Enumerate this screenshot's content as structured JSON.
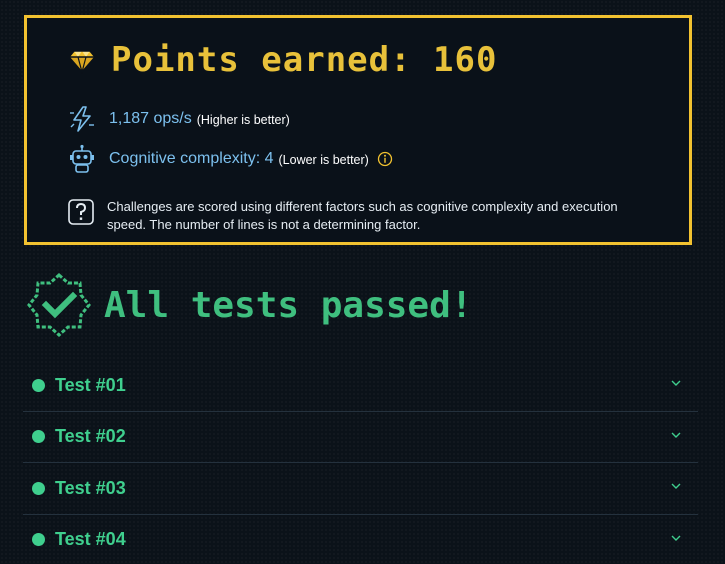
{
  "points": {
    "title": "Points earned: 160"
  },
  "metrics": {
    "speed_value": "1,187 ops/s",
    "speed_note": "(Higher is better)",
    "complexity_value": "Cognitive complexity: 4",
    "complexity_note": "(Lower is better)"
  },
  "scoring_note": "Challenges are scored using different factors such as cognitive complexity and execution speed. The number of lines is not a determining factor.",
  "result": {
    "title": "All tests passed!"
  },
  "tests": [
    {
      "label": "Test #01"
    },
    {
      "label": "Test #02"
    },
    {
      "label": "Test #03"
    },
    {
      "label": "Test #04"
    }
  ],
  "colors": {
    "gold": "#f2c230",
    "green": "#3fcf8e",
    "blue": "#7cc0ee",
    "background": "#0b1219"
  },
  "icons": [
    "gem-icon",
    "lightning-icon",
    "robot-icon",
    "question-icon",
    "info-icon",
    "check-badge-icon",
    "chevron-down-icon"
  ]
}
